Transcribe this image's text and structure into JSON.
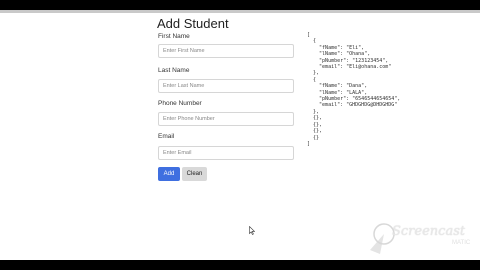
{
  "form": {
    "title": "Add Student",
    "first_name_label": "First Name",
    "first_name_placeholder": "Enter First Name",
    "last_name_label": "Last Name",
    "last_name_placeholder": "Enter Last Name",
    "phone_label": "Phone Number",
    "phone_placeholder": "Enter Phone Number",
    "email_label": "Email",
    "email_placeholder": "Enter Email",
    "add_label": "Add",
    "clean_label": "Clean"
  },
  "json_output": "[\n  {\n    \"fName\": \"Eli\",\n    \"lName\": \"Ohana\",\n    \"pNumber\": \"123123454\",\n    \"email\": \"Eli@ohana.com\"\n  },\n  {\n    \"fName\": \"Dana\",\n    \"lName\": \"LALA\",\n    \"pNumber\": \"6546544654654\",\n    \"email\": \"GHDGHDG@DHDGHDG\"\n  },\n  {},\n  {},\n  {},\n  {}\n]",
  "watermark": {
    "brand": "Screencast",
    "suffix": "MATIC"
  },
  "colors": {
    "primary_button": "#3f6fe0",
    "secondary_button": "#d9d9d9"
  }
}
